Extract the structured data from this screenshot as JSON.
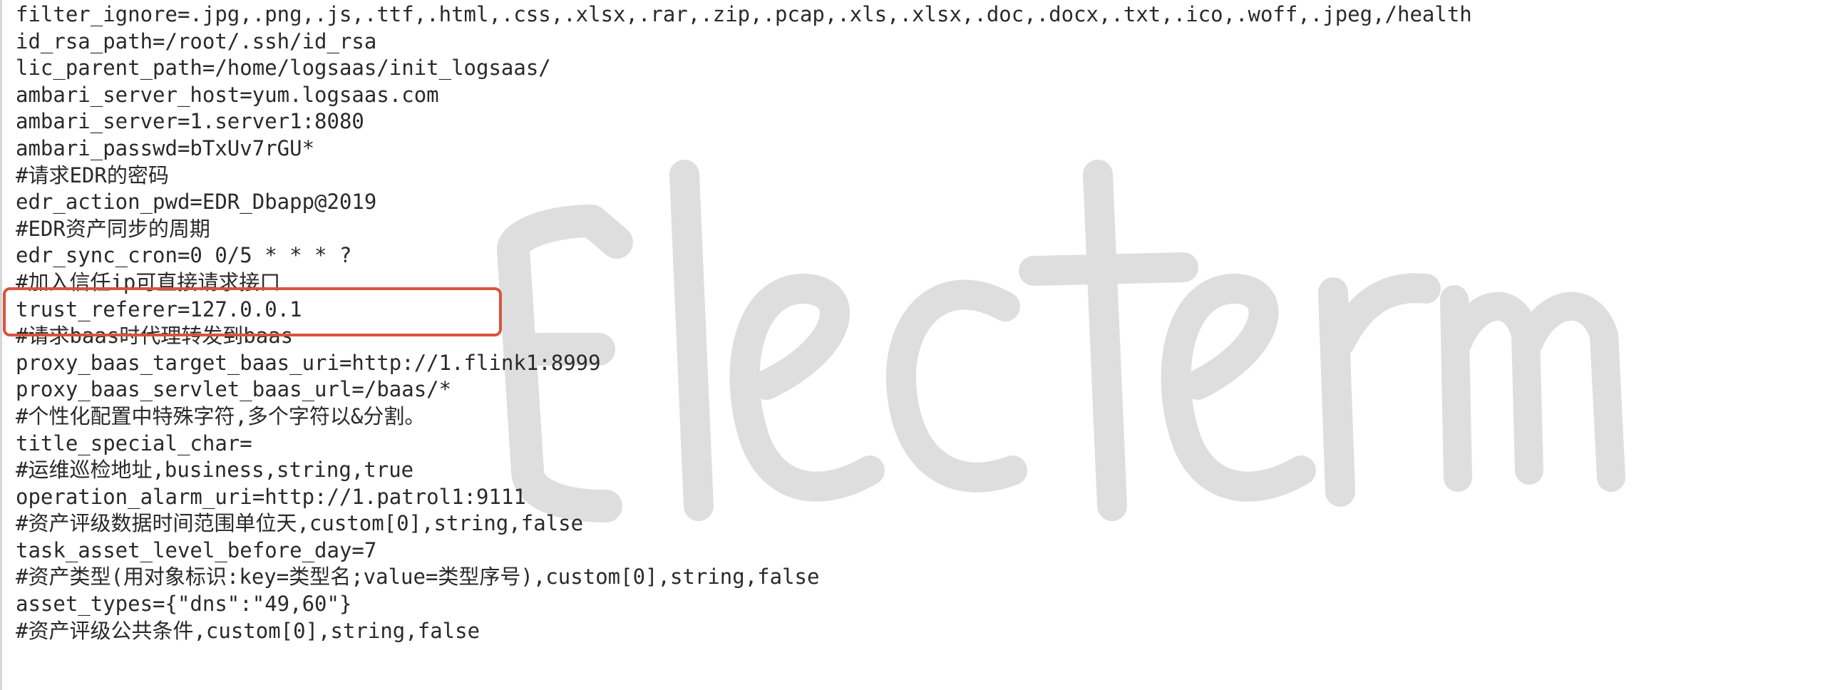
{
  "watermark": {
    "icon": "electerm-watermark",
    "text": "Electerm",
    "color": "#dedede"
  },
  "highlight": {
    "color": "#d9533f",
    "line_index": 11
  },
  "lines": [
    "filter_ignore=.jpg,.png,.js,.ttf,.html,.css,.xlsx,.rar,.zip,.pcap,.xls,.xlsx,.doc,.docx,.txt,.ico,.woff,.jpeg,/health",
    "id_rsa_path=/root/.ssh/id_rsa",
    "lic_parent_path=/home/logsaas/init_logsaas/",
    "ambari_server_host=yum.logsaas.com",
    "ambari_server=1.server1:8080",
    "ambari_passwd=bTxUv7rGU*",
    "#请求EDR的密码",
    "edr_action_pwd=EDR_Dbapp@2019",
    "#EDR资产同步的周期",
    "edr_sync_cron=0 0/5 * * * ?",
    "#加入信任ip可直接请求接口",
    "trust_referer=127.0.0.1",
    "#请求baas时代理转发到baas",
    "proxy_baas_target_baas_uri=http://1.flink1:8999",
    "proxy_baas_servlet_baas_url=/baas/*",
    "#个性化配置中特殊字符,多个字符以&分割。",
    "title_special_char=",
    "#运维巡检地址,business,string,true",
    "operation_alarm_uri=http://1.patrol1:9111",
    "#资产评级数据时间范围单位天,custom[0],string,false",
    "task_asset_level_before_day=7",
    "#资产类型(用对象标识:key=类型名;value=类型序号),custom[0],string,false",
    "asset_types={\"dns\":\"49,60\"}",
    "#资产评级公共条件,custom[0],string,false"
  ]
}
